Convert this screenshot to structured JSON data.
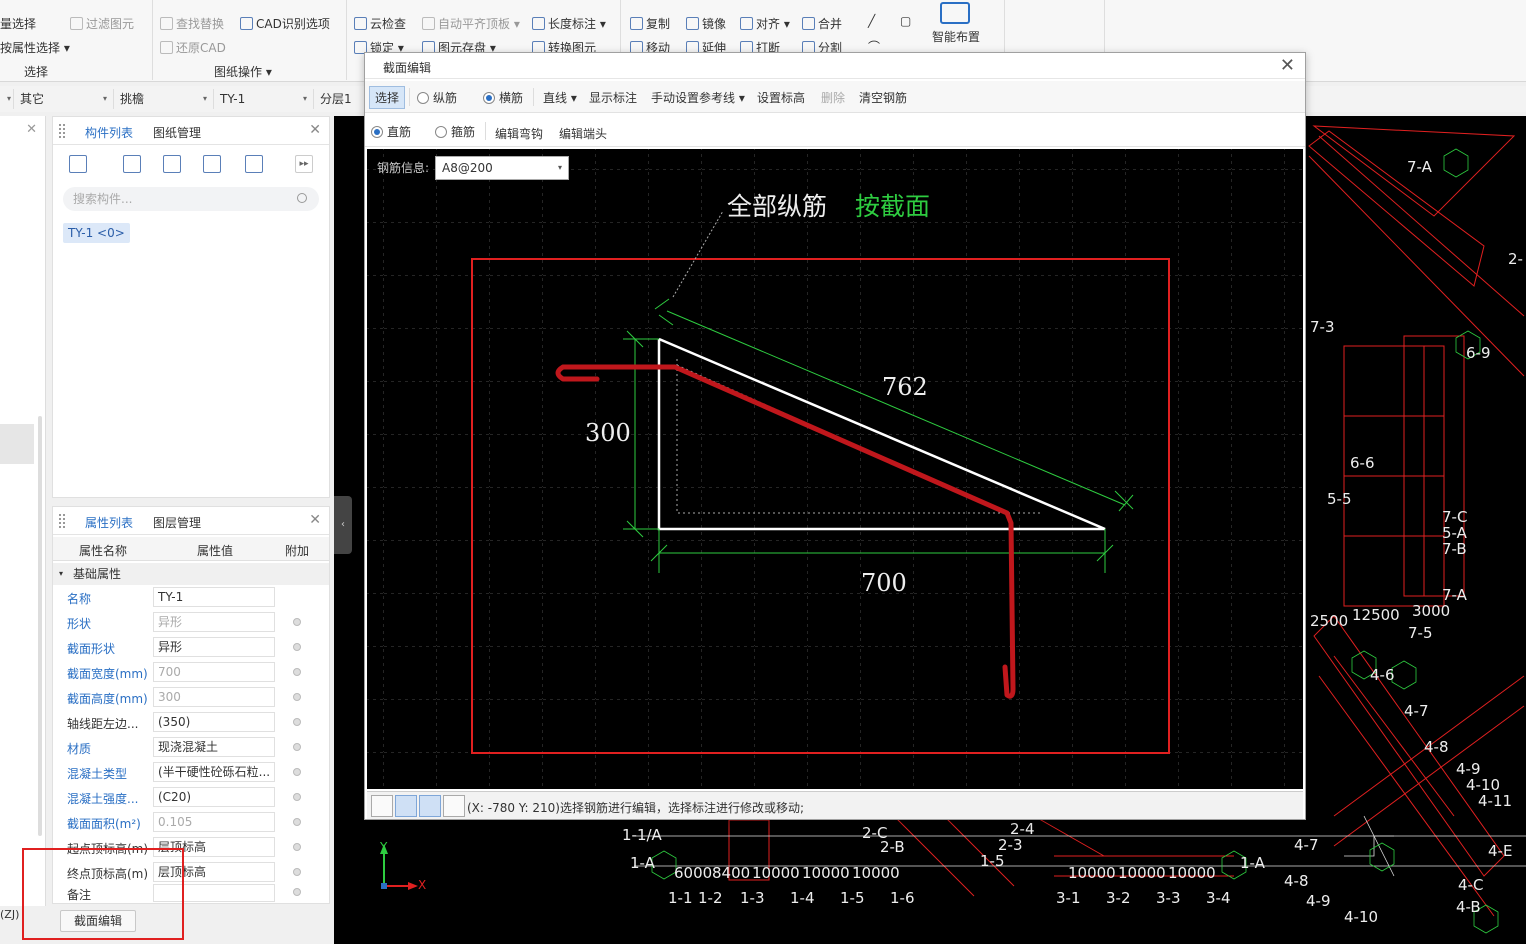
{
  "ribbon": {
    "row1": [
      "量选择",
      "过滤图元",
      "查找替换",
      "CAD识别选项",
      "云检查",
      "自动平齐顶板",
      "长度标注",
      "复制",
      "镜像",
      "对齐",
      "合并"
    ],
    "row2": [
      "按属性选择",
      "还原CAD",
      "锁定",
      "图元存盘",
      "转换图元",
      "移动",
      "延伸",
      "打断",
      "分割"
    ],
    "smart": "智能布置",
    "group_select": "选择",
    "group_drawing": "图纸操作"
  },
  "selector": {
    "type": "其它",
    "category": "挑檐",
    "component": "TY-1",
    "floor": "分层1"
  },
  "component_panel": {
    "tab_list": "构件列表",
    "tab_drawing": "图纸管理",
    "search_placeholder": "搜索构件...",
    "chip": "TY-1 <0>"
  },
  "property_panel": {
    "tab_props": "属性列表",
    "tab_layers": "图层管理",
    "col_name": "属性名称",
    "col_value": "属性值",
    "col_extra": "附加",
    "group": "基础属性",
    "rows": [
      {
        "name": "名称",
        "value": "TY-1"
      },
      {
        "name": "形状",
        "value": "异形"
      },
      {
        "name": "截面形状",
        "value": "异形"
      },
      {
        "name": "截面宽度(mm)",
        "value": "700"
      },
      {
        "name": "截面高度(mm)",
        "value": "300"
      },
      {
        "name": "轴线距左边...",
        "value": "(350)"
      },
      {
        "name": "材质",
        "value": "现浇混凝土"
      },
      {
        "name": "混凝土类型",
        "value": "(半干硬性砼砾石粒..."
      },
      {
        "name": "混凝土强度...",
        "value": "(C20)"
      },
      {
        "name": "截面面积(m²)",
        "value": "0.105"
      },
      {
        "name": "起点顶标高(m)",
        "value": "层顶标高"
      },
      {
        "name": "终点顶标高(m)",
        "value": "层顶标高"
      },
      {
        "name": "备注",
        "value": ""
      }
    ],
    "section_button": "截面编辑"
  },
  "left_strip": [
    "(ZJ)"
  ],
  "dialog": {
    "title": "截面编辑",
    "toolbar1": {
      "select": "选择",
      "longitudinal": "纵筋",
      "transverse": "横筋",
      "line": "直线",
      "show_dim": "显示标注",
      "manual_ref": "手动设置参考线",
      "set_elev": "设置标高",
      "delete": "删除",
      "clear": "清空钢筋"
    },
    "toolbar2": {
      "straight": "直筋",
      "stirrup": "箍筋",
      "edit_hook": "编辑弯钩",
      "edit_end": "编辑端头"
    },
    "rebar_label": "钢筋信息:",
    "rebar_value": "A8@200",
    "annotation_all": "全部纵筋",
    "annotation_mode": "按截面",
    "dim_top": "762",
    "dim_left": "300",
    "dim_bottom": "700",
    "status_text": "(X: -780 Y: 210)选择钢筋进行编辑，选择标注进行修改或移动;"
  },
  "cad_labels": [
    "7-A",
    "2-",
    "6-9",
    "7-3",
    "6-6",
    "5-5",
    "7-C",
    "5-A",
    "7-B",
    "7-A",
    "7-5",
    "4-6",
    "4-7",
    "4-8",
    "4-9",
    "4-10",
    "4-11",
    "4-E",
    "4-C",
    "4-B",
    "4-10",
    "1-1/A",
    "1-A",
    "2-C",
    "2-B",
    "2-4",
    "2-3",
    "1-5",
    "1-A",
    "4-7",
    "4-8",
    "4-9",
    "1-1",
    "1-2",
    "1-3",
    "1-4",
    "1-5",
    "1-6",
    "3-1",
    "3-2",
    "3-3",
    "3-4",
    "6000",
    "8400",
    "10000",
    "10000",
    "10000",
    "10000",
    "10000",
    "10000",
    "12500",
    "3000",
    "2500"
  ],
  "colors": {
    "accent": "#2a6fc4",
    "cad_red": "#e02020",
    "cad_green": "#2ecc40",
    "rebar": "#c0171c"
  }
}
